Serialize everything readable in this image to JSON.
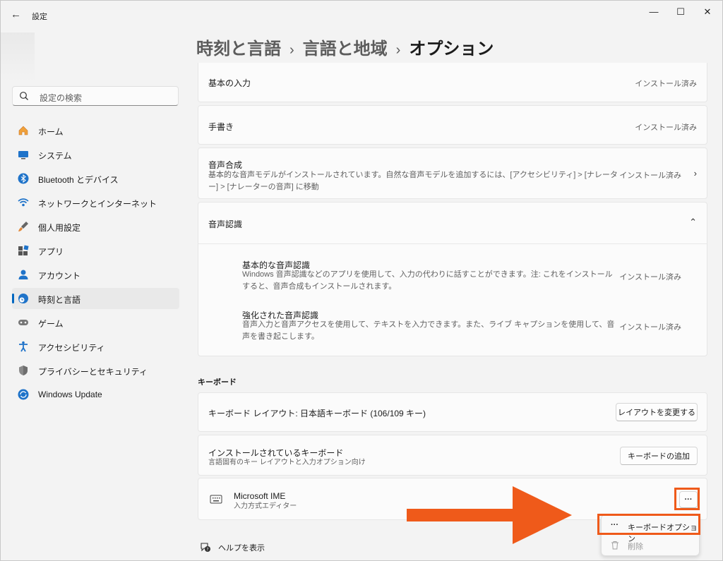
{
  "window": {
    "app_title": "設定",
    "back_icon": "back-arrow-icon",
    "controls": [
      "minimize-icon",
      "maximize-icon",
      "close-icon"
    ]
  },
  "search": {
    "placeholder": "設定の検索",
    "icon": "search-icon"
  },
  "nav": [
    {
      "label": "ホーム",
      "icon": "home-icon",
      "selected": false
    },
    {
      "label": "システム",
      "icon": "system-icon",
      "selected": false
    },
    {
      "label": "Bluetooth とデバイス",
      "icon": "bluetooth-icon",
      "selected": false
    },
    {
      "label": "ネットワークとインターネット",
      "icon": "wifi-icon",
      "selected": false
    },
    {
      "label": "個人用設定",
      "icon": "brush-icon",
      "selected": false
    },
    {
      "label": "アプリ",
      "icon": "apps-icon",
      "selected": false
    },
    {
      "label": "アカウント",
      "icon": "account-icon",
      "selected": false
    },
    {
      "label": "時刻と言語",
      "icon": "time-language-icon",
      "selected": true
    },
    {
      "label": "ゲーム",
      "icon": "gamepad-icon",
      "selected": false
    },
    {
      "label": "アクセシビリティ",
      "icon": "accessibility-icon",
      "selected": false
    },
    {
      "label": "プライバシーとセキュリティ",
      "icon": "shield-icon",
      "selected": false
    },
    {
      "label": "Windows Update",
      "icon": "update-icon",
      "selected": false
    }
  ],
  "breadcrumb": {
    "level1": "時刻と言語",
    "level2": "言語と地域",
    "current": "オプション",
    "separator": "›"
  },
  "features": {
    "basic_input": {
      "title": "基本の入力",
      "status": "インストール済み"
    },
    "handwriting": {
      "title": "手書き",
      "status": "インストール済み"
    },
    "tts": {
      "title": "音声合成",
      "desc": "基本的な音声モデルがインストールされています。自然な音声モデルを追加するには、[アクセシビリティ] > [ナレーター] > [ナレーターの音声] に移動",
      "status": "インストール済み"
    },
    "speech": {
      "title": "音声認識",
      "sub": [
        {
          "title": "基本的な音声認識",
          "desc": "Windows 音声認識などのアプリを使用して、入力の代わりに話すことができます。注: これをインストールすると、音声合成もインストールされます。",
          "status": "インストール済み"
        },
        {
          "title": "強化された音声認識",
          "desc": "音声入力と音声アクセスを使用して、テキストを入力できます。また、ライブ キャプションを使用して、音声を書き起こします。",
          "status": "インストール済み"
        }
      ]
    }
  },
  "keyboard": {
    "heading": "キーボード",
    "layout_label": "キーボード レイアウト: 日本語キーボード (106/109 キー)",
    "change_layout_button": "レイアウトを変更する",
    "installed_title": "インストールされているキーボード",
    "installed_desc": "言語固有のキー レイアウトと入力オプション向け",
    "add_button": "キーボードの追加",
    "ime": {
      "name": "Microsoft IME",
      "desc": "入力方式エディター",
      "more": "···"
    }
  },
  "context_menu": {
    "options": {
      "icon": "···",
      "label": "キーボードオプション"
    },
    "remove": {
      "icon": "trash-icon",
      "label": "削除"
    }
  },
  "help": {
    "label": "ヘルプを表示",
    "icon": "help-icon"
  },
  "colors": {
    "accent": "#0067c0",
    "highlight": "#ef5a1a"
  }
}
